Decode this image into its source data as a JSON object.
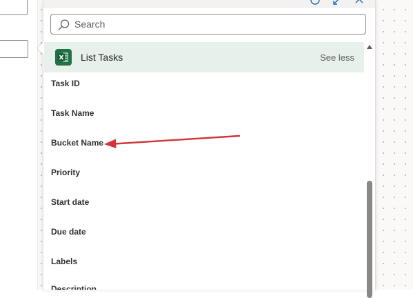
{
  "search": {
    "placeholder": "Search"
  },
  "action": {
    "title": "List Tasks",
    "toggle_label": "See less",
    "accent_color": "#1f7244",
    "icon": "excel-icon"
  },
  "fields": [
    {
      "label": "Task ID"
    },
    {
      "label": "Task Name"
    },
    {
      "label": "Bucket Name"
    },
    {
      "label": "Priority"
    },
    {
      "label": "Start date"
    },
    {
      "label": "Due date"
    },
    {
      "label": "Labels"
    },
    {
      "label": "Description"
    }
  ],
  "annotation": {
    "type": "arrow",
    "color": "#d13438",
    "points_to": "Bucket Name"
  },
  "top_icons": [
    "info-icon",
    "expand-icon",
    "close-icon"
  ]
}
